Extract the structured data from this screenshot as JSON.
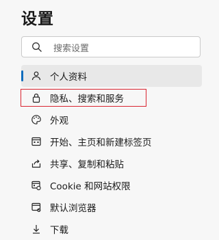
{
  "page": {
    "title": "设置"
  },
  "search": {
    "placeholder": "搜索设置"
  },
  "nav": {
    "items": [
      {
        "label": "个人资料",
        "icon": "profile-icon"
      },
      {
        "label": "隐私、搜索和服务",
        "icon": "lock-icon"
      },
      {
        "label": "外观",
        "icon": "palette-icon"
      },
      {
        "label": "开始、主页和新建标签页",
        "icon": "start-page-icon"
      },
      {
        "label": "共享、复制和粘贴",
        "icon": "share-icon"
      },
      {
        "label": "Cookie 和网站权限",
        "icon": "site-permissions-icon"
      },
      {
        "label": "默认浏览器",
        "icon": "default-browser-icon"
      },
      {
        "label": "下载",
        "icon": "download-icon"
      }
    ]
  },
  "colors": {
    "accent": "#0f6cbd",
    "highlight_outline": "#d9232f"
  }
}
